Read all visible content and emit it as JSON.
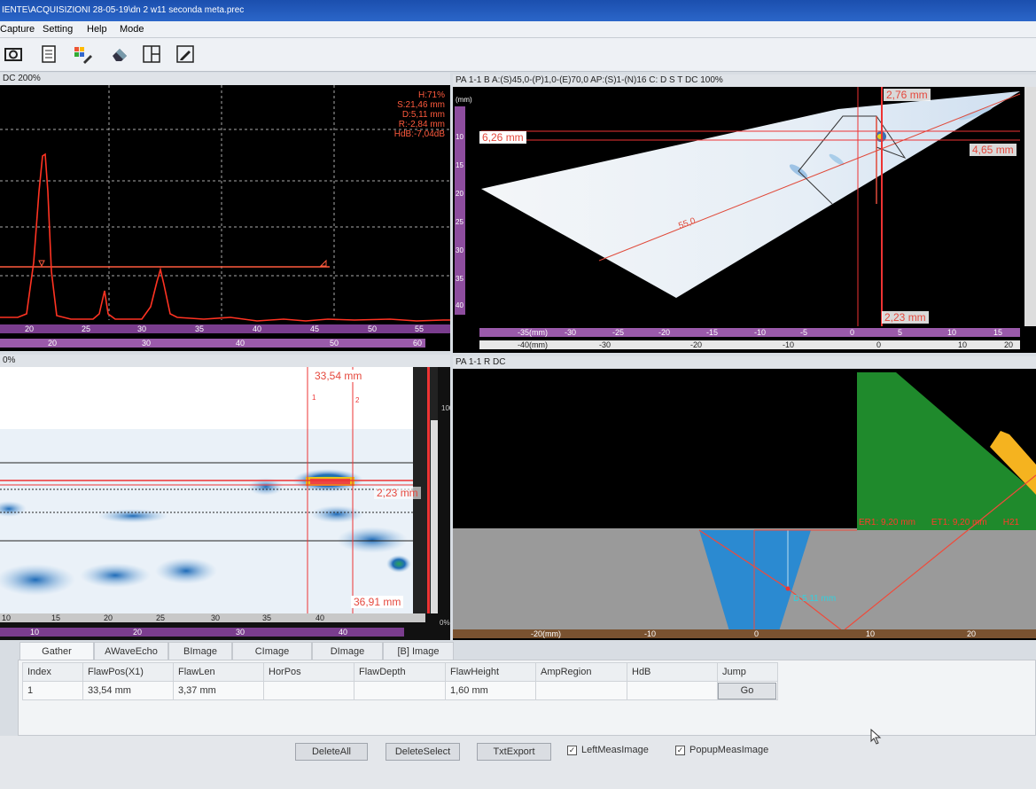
{
  "window": {
    "title": "IENTE\\ACQUISIZIONI 28-05-19\\dn 2 w11 seconda meta.prec"
  },
  "menu": [
    "Capture",
    "Setting",
    "Help",
    "Mode"
  ],
  "toolbar_icons": [
    "camera-icon",
    "report-icon",
    "palette-icon",
    "eraser-icon",
    "layout-icon",
    "edit-icon"
  ],
  "ascan": {
    "header": "DC 200%",
    "readout": [
      "H:71%",
      "S:21,46 mm",
      "D:5,11 mm",
      "R:-2,84 mm",
      "HdB:-7,04dB"
    ],
    "ruler_top": [
      "20",
      "25",
      "30",
      "35",
      "40",
      "45",
      "50",
      "55"
    ],
    "ruler_bottom": [
      "20",
      "30",
      "40",
      "50",
      "60"
    ]
  },
  "sscan": {
    "header": "PA 1-1 B A:(S)45,0-(P)1,0-(E)70,0 AP:(S)1-(N)16 C: D S T  DC 100%",
    "labels": {
      "top": "2,76 mm",
      "left": "6,26 mm",
      "right": "4,65 mm",
      "bottom": "2,23 mm",
      "beam": "55,0"
    },
    "ruler_unit": "-35(mm)",
    "ruler_labels": [
      "-30",
      "-25",
      "-20",
      "-15",
      "-10",
      "-5",
      "0",
      "5",
      "10",
      "15"
    ],
    "ruler2_unit": "-40(mm)",
    "ruler2_labels": [
      "-30",
      "-20",
      "-10",
      "0",
      "10",
      "20"
    ],
    "vscale_unit": "(mm)",
    "vscale_labels": [
      "10",
      "15",
      "20",
      "25",
      "30",
      "35",
      "40"
    ]
  },
  "cscan": {
    "header": "0%",
    "labels": {
      "top": "33,54 mm",
      "right": "2,23 mm",
      "bottom": "36,91 mm"
    },
    "cursor_marks": [
      "1",
      "2"
    ],
    "ruler_labels": [
      "10",
      "15",
      "20",
      "25",
      "30",
      "35",
      "40"
    ],
    "ruler2_labels": [
      "10",
      "20",
      "30",
      "40"
    ],
    "color_scale": [
      "100%",
      "0%"
    ]
  },
  "rview": {
    "header": "PA 1-1 R DC",
    "readouts": [
      "ER1: 9,20 mm",
      "ET1: 9,20 mm",
      "H21"
    ],
    "beam_label": "D:5,11 mm",
    "ruler_unit": "-20(mm)",
    "ruler_labels": [
      "-10",
      "0",
      "10",
      "20"
    ]
  },
  "tabs": [
    "Gather",
    "AWaveEcho",
    "BImage",
    "CImage",
    "DImage",
    "[B] Image"
  ],
  "table": {
    "headers": [
      "Index",
      "FlawPos(X1)",
      "FlawLen",
      "HorPos",
      "FlawDepth",
      "FlawHeight",
      "AmpRegion",
      "HdB",
      "Jump"
    ],
    "rows": [
      [
        "1",
        "33,54 mm",
        "3,37 mm",
        "",
        "",
        "1,60 mm",
        "",
        "",
        "Go"
      ]
    ]
  },
  "bottom": {
    "buttons": [
      "DeleteAll",
      "DeleteSelect",
      "TxtExport"
    ],
    "checkboxes": [
      {
        "label": "LeftMeasImage",
        "checked": true
      },
      {
        "label": "PopupMeasImage",
        "checked": true
      }
    ]
  },
  "colors": {
    "accent_red": "#e5483d",
    "trace": "#ff3322",
    "ruler_purple": "#7a3d8e",
    "titlebar_blue": "#2b66c9"
  }
}
